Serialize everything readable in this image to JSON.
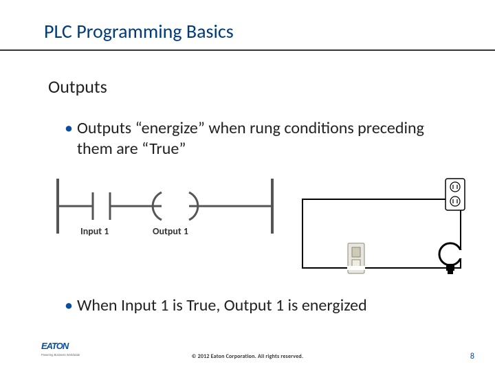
{
  "title": "PLC Programming Basics",
  "subtitle": "Outputs",
  "bullets": [
    "Outputs “energize” when rung conditions preceding them are “True”",
    "When Input 1 is True, Output 1 is energized"
  ],
  "ladder": {
    "input_label": "Input 1",
    "output_label": "Output 1"
  },
  "footer": {
    "brand": "EATON",
    "tagline": "Powering Business Worldwide",
    "copyright": "© 2012 Eaton Corporation. All rights reserved.",
    "page": "8"
  }
}
